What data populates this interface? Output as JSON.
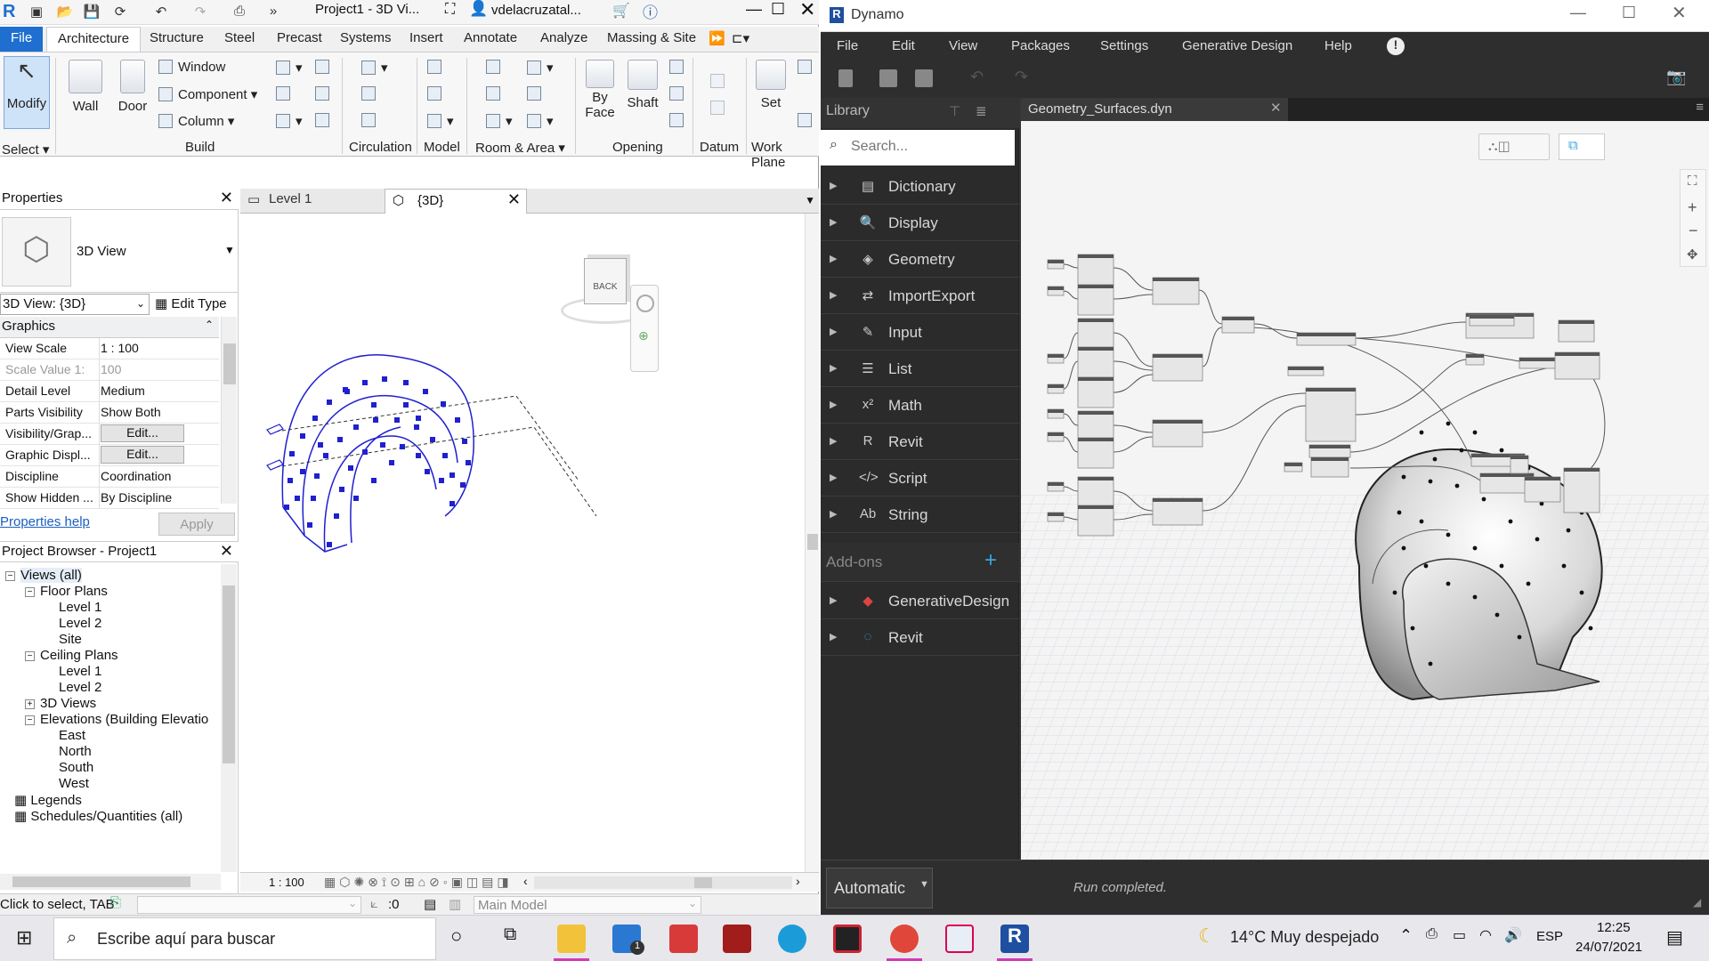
{
  "revit": {
    "title": "Project1 - 3D Vi...",
    "user": "vdelacruzatal...",
    "tabs": [
      "File",
      "Architecture",
      "Structure",
      "Steel",
      "Precast",
      "Systems",
      "Insert",
      "Annotate",
      "Analyze",
      "Massing & Site"
    ],
    "ribbon": {
      "modify": "Modify",
      "select": "Select",
      "wall": "Wall",
      "door": "Door",
      "window": "Window",
      "component": "Component",
      "column": "Column",
      "build": "Build",
      "circulation": "Circulation",
      "model": "Model",
      "room_area": "Room & Area",
      "by_face": "By Face",
      "by": "By",
      "face": "Face",
      "shaft": "Shaft",
      "opening": "Opening",
      "datum": "Datum",
      "set": "Set",
      "work_plane": "Work Plane"
    },
    "properties": {
      "title": "Properties",
      "type_name": "3D View",
      "selector": "3D View: {3D}",
      "edit_type": "Edit Type",
      "section": "Graphics",
      "rows": [
        {
          "key": "View Scale",
          "value": "1 : 100"
        },
        {
          "key": "Scale Value    1:",
          "value": "100"
        },
        {
          "key": "Detail Level",
          "value": "Medium"
        },
        {
          "key": "Parts Visibility",
          "value": "Show Both"
        },
        {
          "key": "Visibility/Grap...",
          "value": "Edit..."
        },
        {
          "key": "Graphic Displ...",
          "value": "Edit..."
        },
        {
          "key": "Discipline",
          "value": "Coordination"
        },
        {
          "key": "Show Hidden ...",
          "value": "By Discipline"
        }
      ],
      "help": "Properties help",
      "apply": "Apply"
    },
    "browser": {
      "title": "Project Browser - Project1",
      "items": [
        {
          "label": "Views (all)",
          "indent": 0,
          "box": "−"
        },
        {
          "label": "Floor Plans",
          "indent": 1,
          "box": "−"
        },
        {
          "label": "Level 1",
          "indent": 2,
          "box": ""
        },
        {
          "label": "Level 2",
          "indent": 2,
          "box": ""
        },
        {
          "label": "Site",
          "indent": 2,
          "box": ""
        },
        {
          "label": "Ceiling Plans",
          "indent": 1,
          "box": "−"
        },
        {
          "label": "Level 1",
          "indent": 2,
          "box": ""
        },
        {
          "label": "Level 2",
          "indent": 2,
          "box": ""
        },
        {
          "label": "3D Views",
          "indent": 1,
          "box": "+"
        },
        {
          "label": "Elevations (Building Elevatio",
          "indent": 1,
          "box": "−"
        },
        {
          "label": "East",
          "indent": 2,
          "box": ""
        },
        {
          "label": "North",
          "indent": 2,
          "box": ""
        },
        {
          "label": "South",
          "indent": 2,
          "box": ""
        },
        {
          "label": "West",
          "indent": 2,
          "box": ""
        },
        {
          "label": "Legends",
          "indent": 0,
          "box": ""
        },
        {
          "label": "Schedules/Quantities (all)",
          "indent": 0,
          "box": ""
        }
      ]
    },
    "view_tabs": [
      "Level 1",
      "{3D}"
    ],
    "viewcube_label": "BACK",
    "view_scale": "1 : 100",
    "status": "Click to select, TAB",
    "status_zero": ":0",
    "main_model": "Main Model"
  },
  "dynamo": {
    "title": "Dynamo",
    "menu": [
      "File",
      "Edit",
      "View",
      "Packages",
      "Settings",
      "Generative Design",
      "Help"
    ],
    "library_title": "Library",
    "search_placeholder": "Search...",
    "library": [
      {
        "label": "Dictionary",
        "icon": "▤"
      },
      {
        "label": "Display",
        "icon": "🔍"
      },
      {
        "label": "Geometry",
        "icon": "◈"
      },
      {
        "label": "ImportExport",
        "icon": "⇄"
      },
      {
        "label": "Input",
        "icon": "✎"
      },
      {
        "label": "List",
        "icon": "☰"
      },
      {
        "label": "Math",
        "icon": "x²"
      },
      {
        "label": "Revit",
        "icon": "R"
      },
      {
        "label": "Script",
        "icon": "</>"
      },
      {
        "label": "String",
        "icon": "Ab"
      }
    ],
    "addons_title": "Add-ons",
    "addons": [
      {
        "label": "GenerativeDesign",
        "icon": "◆"
      },
      {
        "label": "Revit",
        "icon": "◌"
      }
    ],
    "file_tab": "Geometry_Surfaces.dyn",
    "run_mode": "Automatic",
    "run_status": "Run completed."
  },
  "taskbar": {
    "search": "Escribe aquí para buscar",
    "weather": "14°C  Muy despejado",
    "lang": "ESP",
    "time": "12:25",
    "date": "24/07/2021",
    "mail_badge": "1"
  },
  "colors": {
    "revit_accent": "#1e6fd0",
    "selection_blue": "#2020d0",
    "dynamo_bg": "#353535",
    "dynamo_library": "#2b2b2b",
    "taskbar_underline": "#d13ab5"
  }
}
